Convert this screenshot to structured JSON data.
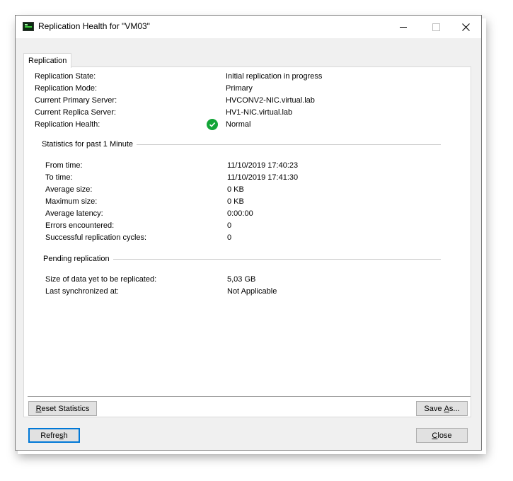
{
  "window": {
    "title": "Replication Health for \"VM03\"",
    "icon": "hyperv-vm-icon"
  },
  "tabs": [
    {
      "label": "Replication",
      "selected": true
    }
  ],
  "details": {
    "state_label": "Replication State:",
    "state_value": "Initial replication in progress",
    "mode_label": "Replication Mode:",
    "mode_value": "Primary",
    "primary_label": "Current Primary Server:",
    "primary_value": "HVCONV2-NIC.virtual.lab",
    "replica_label": "Current Replica Server:",
    "replica_value": "HV1-NIC.virtual.lab",
    "health_label": "Replication Health:",
    "health_value": "Normal",
    "health_icon": "check-circle-icon",
    "health_color": "#13a538"
  },
  "statistics": {
    "title": "Statistics for past 1 Minute",
    "from_label": "From time:",
    "from_value": "11/10/2019 17:40:23",
    "to_label": "To time:",
    "to_value": "11/10/2019 17:41:30",
    "avg_size_label": "Average size:",
    "avg_size_value": "0 KB",
    "max_size_label": "Maximum size:",
    "max_size_value": "0 KB",
    "avg_latency_label": "Average latency:",
    "avg_latency_value": "0:00:00",
    "errors_label": "Errors encountered:",
    "errors_value": "0",
    "cycles_label": "Successful replication cycles:",
    "cycles_value": "0"
  },
  "pending": {
    "title": "Pending replication",
    "size_label": "Size of data yet to be replicated:",
    "size_value": "5,03 GB",
    "last_sync_label": "Last synchronized at:",
    "last_sync_value": "Not Applicable"
  },
  "buttons": {
    "reset_pre": "",
    "reset_u": "R",
    "reset_post": "eset Statistics",
    "save_pre": "Save ",
    "save_u": "A",
    "save_post": "s...",
    "refresh_pre": "Refre",
    "refresh_u": "s",
    "refresh_post": "h",
    "close_pre": "",
    "close_u": "C",
    "close_post": "lose"
  },
  "colors": {
    "accent": "#0078d7",
    "window_bg": "#f0f0f0"
  }
}
